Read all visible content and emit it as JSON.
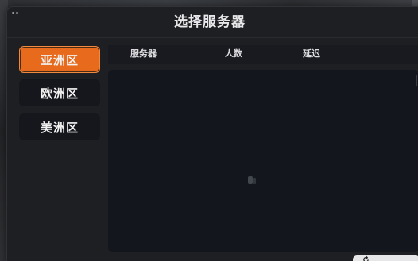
{
  "dialog": {
    "title": "选择服务器"
  },
  "regions": [
    {
      "label": "亚洲区",
      "active": true
    },
    {
      "label": "欧洲区",
      "active": false
    },
    {
      "label": "美洲区",
      "active": false
    }
  ],
  "server_list": {
    "columns": [
      "服务器",
      "人数",
      "延迟"
    ],
    "rows": [],
    "loading_icon": "spinner-icon"
  },
  "colors": {
    "accent": "#e86a1c",
    "panel": "#1e1f22",
    "list_bg": "#13161c"
  },
  "footer": {
    "refresh_icon": "refresh-icon"
  }
}
